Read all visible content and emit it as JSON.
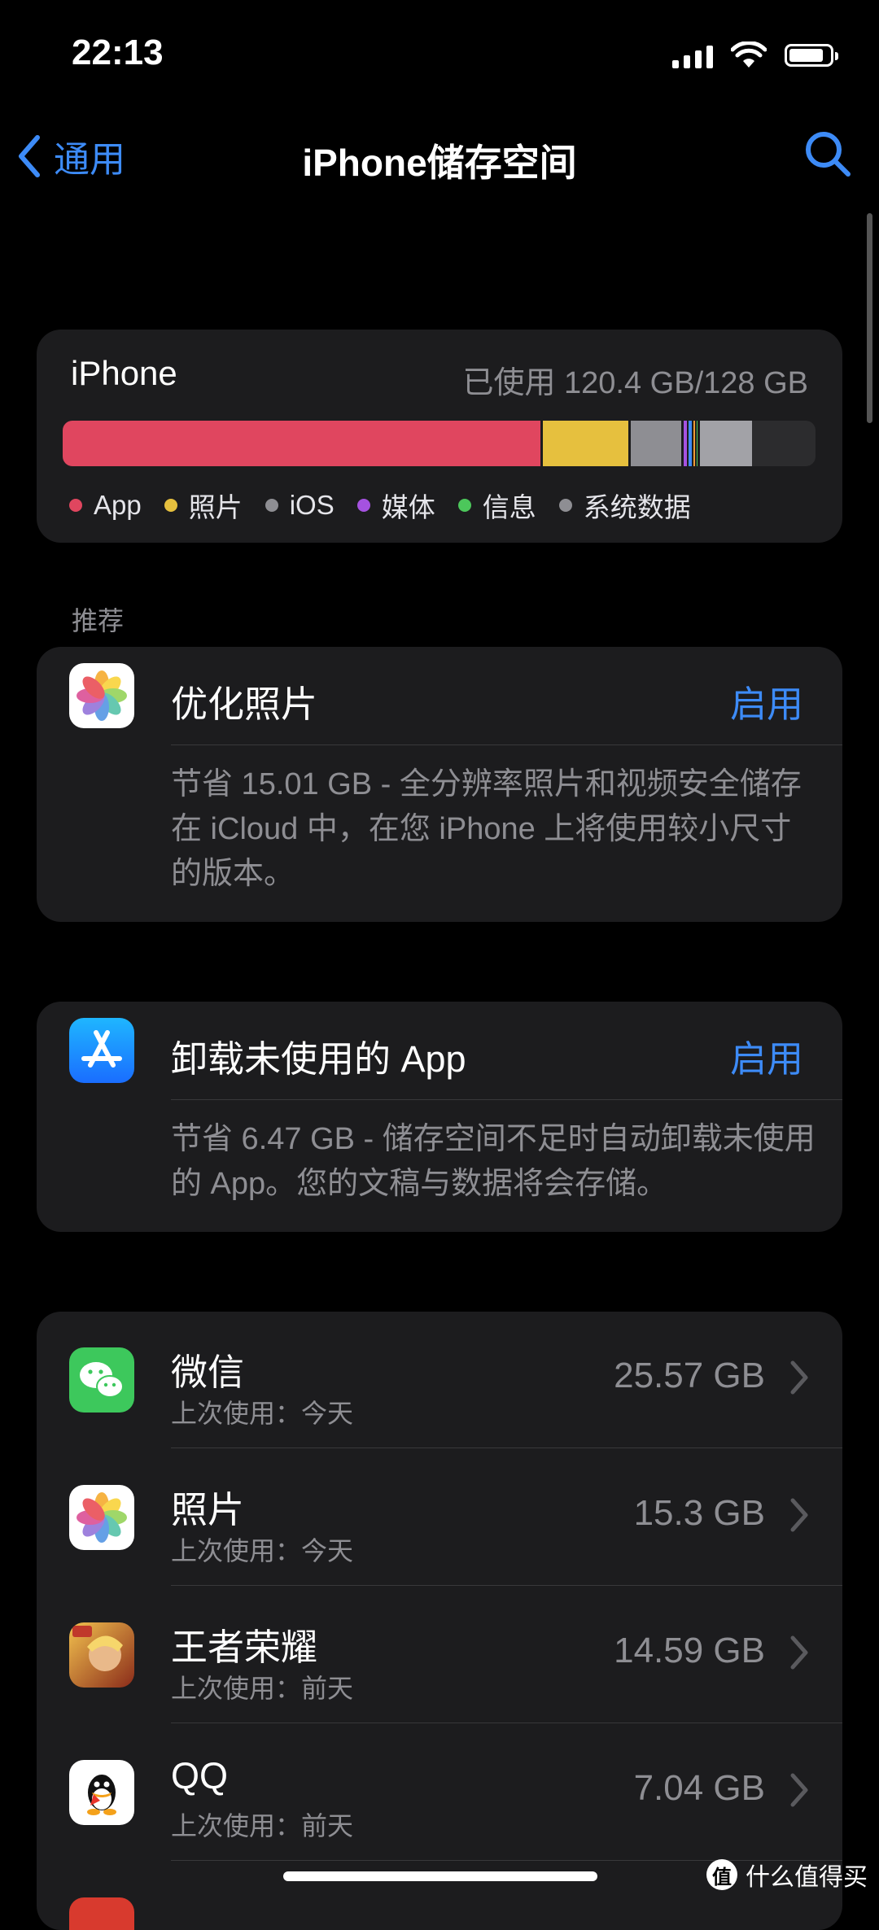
{
  "status_bar": {
    "time": "22:13",
    "battery_level": 0.85
  },
  "nav": {
    "back_label": "通用",
    "title": "iPhone储存空间"
  },
  "storage": {
    "device_name": "iPhone",
    "used_text": "已使用 120.4 GB/128 GB",
    "legend": [
      {
        "label": "App",
        "color": "#e0465f"
      },
      {
        "label": "照片",
        "color": "#e6c03e"
      },
      {
        "label": "iOS",
        "color": "#8e8e93"
      },
      {
        "label": "媒体",
        "color": "#a552e0"
      },
      {
        "label": "信息",
        "color": "#4cc75b"
      },
      {
        "label": "系统数据",
        "color": "#8e8e93"
      }
    ]
  },
  "section": {
    "recommend_label": "推荐"
  },
  "recommendations": [
    {
      "icon": "photos-icon",
      "title": "优化照片",
      "action": "启用",
      "description": "节省 15.01 GB - 全分辨率照片和视频安全储存在 iCloud 中，在您 iPhone 上将使用较小尺寸的版本。"
    },
    {
      "icon": "app-store-icon",
      "title": "卸载未使用的 App",
      "action": "启用",
      "description": "节省 6.47 GB - 储存空间不足时自动卸载未使用的 App。您的文稿与数据将会存储。"
    }
  ],
  "apps": [
    {
      "name": "微信",
      "last_used": "上次使用：今天",
      "size": "25.57 GB",
      "icon": "wechat-icon"
    },
    {
      "name": "照片",
      "last_used": "上次使用：今天",
      "size": "15.3 GB",
      "icon": "photos-icon"
    },
    {
      "name": "王者荣耀",
      "last_used": "上次使用：前天",
      "size": "14.59 GB",
      "icon": "game-icon"
    },
    {
      "name": "QQ",
      "last_used": "上次使用：前天",
      "size": "7.04 GB",
      "icon": "qq-icon"
    }
  ],
  "watermark": {
    "logo_text": "值",
    "text": "什么值得买"
  }
}
